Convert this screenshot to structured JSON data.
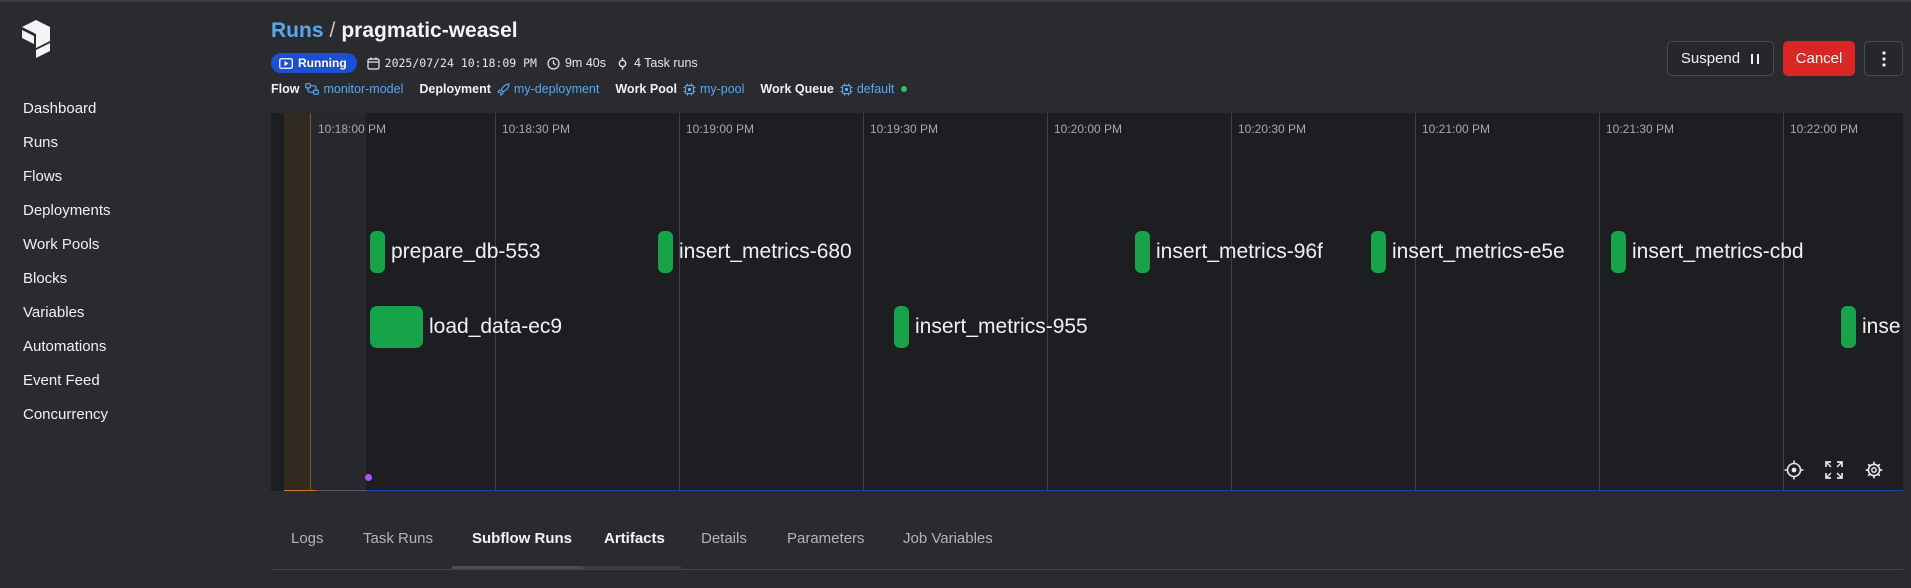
{
  "sidebar": {
    "items": [
      {
        "label": "Dashboard"
      },
      {
        "label": "Runs"
      },
      {
        "label": "Flows"
      },
      {
        "label": "Deployments"
      },
      {
        "label": "Work Pools"
      },
      {
        "label": "Blocks"
      },
      {
        "label": "Variables"
      },
      {
        "label": "Automations"
      },
      {
        "label": "Event Feed"
      },
      {
        "label": "Concurrency"
      }
    ]
  },
  "header": {
    "breadcrumb_root": "Runs",
    "separator": "/",
    "run_name": "pragmatic-weasel",
    "status": "Running",
    "start_time": "2025/07/24 10:18:09 PM",
    "duration": "9m 40s",
    "task_runs": "4 Task runs",
    "flow_label": "Flow",
    "flow": "monitor-model",
    "deployment_label": "Deployment",
    "deployment": "my-deployment",
    "work_pool_label": "Work Pool",
    "work_pool": "my-pool",
    "work_queue_label": "Work Queue",
    "work_queue": "default"
  },
  "actions": {
    "suspend": "Suspend",
    "cancel": "Cancel"
  },
  "timeline": {
    "ticks": [
      "10:18:00 PM",
      "10:18:30 PM",
      "10:19:00 PM",
      "10:19:30 PM",
      "10:20:00 PM",
      "10:20:30 PM",
      "10:21:00 PM",
      "10:21:30 PM",
      "10:22:00 PM"
    ],
    "tasks": [
      {
        "label": "prepare_db-553"
      },
      {
        "label": "insert_metrics-680"
      },
      {
        "label": "insert_metrics-96f"
      },
      {
        "label": "insert_metrics-e5e"
      },
      {
        "label": "insert_metrics-cbd"
      },
      {
        "label": "load_data-ec9"
      },
      {
        "label": "insert_metrics-955"
      },
      {
        "label": "inse"
      }
    ]
  },
  "tabs": [
    {
      "label": "Logs"
    },
    {
      "label": "Task Runs"
    },
    {
      "label": "Subflow Runs"
    },
    {
      "label": "Artifacts"
    },
    {
      "label": "Details"
    },
    {
      "label": "Parameters"
    },
    {
      "label": "Job Variables"
    }
  ],
  "colors": {
    "accent": "#5aa7f0",
    "running": "#1d4ed8",
    "completed": "#16a34a",
    "cancel": "#dc2626"
  }
}
